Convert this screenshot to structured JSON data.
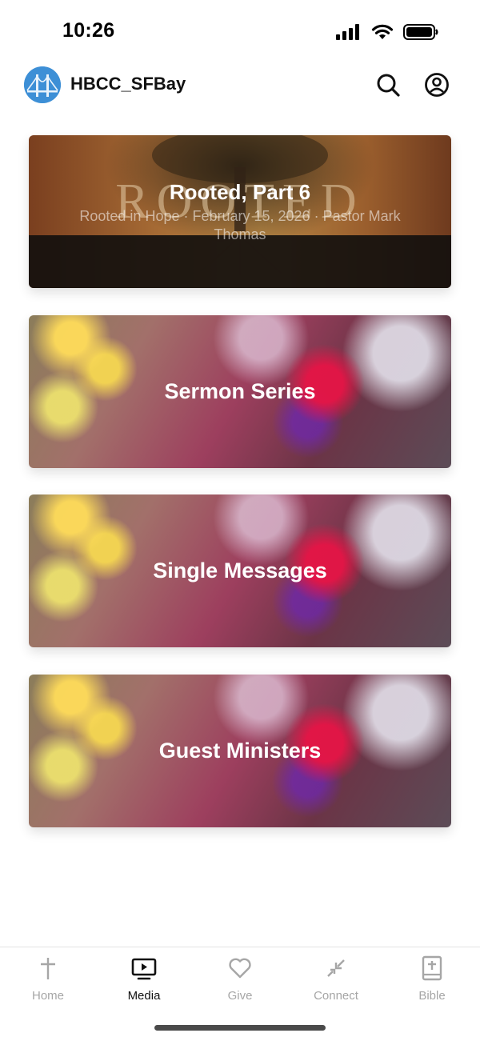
{
  "status_bar": {
    "time": "10:26"
  },
  "header": {
    "title": "HBCC_SFBay"
  },
  "featured": {
    "title": "Rooted, Part 6",
    "subtitle": "Rooted in Hope · February 15, 2026 · Pastor Mark Thomas",
    "watermark": "ROOTED"
  },
  "categories": [
    {
      "label": "Sermon Series"
    },
    {
      "label": "Single Messages"
    },
    {
      "label": "Guest Ministers"
    }
  ],
  "tabs": [
    {
      "label": "Home",
      "icon": "cross-icon"
    },
    {
      "label": "Media",
      "icon": "tv-play-icon",
      "active": true
    },
    {
      "label": "Give",
      "icon": "heart-icon"
    },
    {
      "label": "Connect",
      "icon": "connect-arrows-icon"
    },
    {
      "label": "Bible",
      "icon": "bible-icon"
    }
  ],
  "colors": {
    "accent_avatar": "#3d8fd6",
    "active_tab": "#111111",
    "inactive_tab": "#a6a6a6"
  }
}
